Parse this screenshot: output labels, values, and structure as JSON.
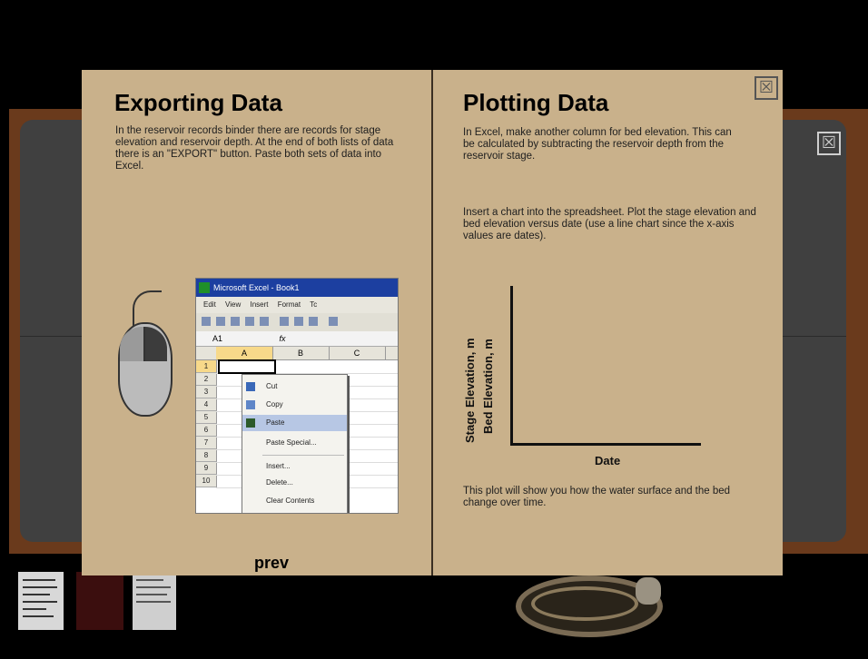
{
  "left_page": {
    "title": "Exporting Data",
    "text": "In the reservoir records binder there are records for stage elevation and reservoir depth.  At the end of both lists of data there is an \"EXPORT\" button. Paste both sets of data into Excel.",
    "prev_label": "prev"
  },
  "right_page": {
    "title": "Plotting Data",
    "text_1": "In Excel, make another column for bed elevation.  This can be calculated by subtracting the reservoir depth from the reservoir stage.",
    "text_2": "Insert a chart into the spreadsheet.  Plot the stage elevation and bed elevation versus date (use a line chart since the x-axis values are dates).",
    "text_3": "This plot will show you how the water surface and the bed change over time.",
    "plot": {
      "y_label_1": "Stage Elevation, m",
      "y_label_2": "Bed Elevation, m",
      "x_label": "Date"
    },
    "close_symbol": "☒"
  },
  "background": {
    "close_symbol": "☒"
  },
  "excel": {
    "title": "Microsoft Excel - Book1",
    "menus": [
      "Edit",
      "View",
      "Insert",
      "Format",
      "Tc"
    ],
    "name_box": "A1",
    "formula_symbol": "fx",
    "columns": [
      "A",
      "B",
      "C"
    ],
    "rows": [
      "1",
      "2",
      "3",
      "4",
      "5",
      "6",
      "7",
      "8",
      "9",
      "10"
    ],
    "context_menu": [
      "Cut",
      "Copy",
      "Paste",
      "Paste Special...",
      "Insert...",
      "Delete...",
      "Clear Contents"
    ]
  }
}
